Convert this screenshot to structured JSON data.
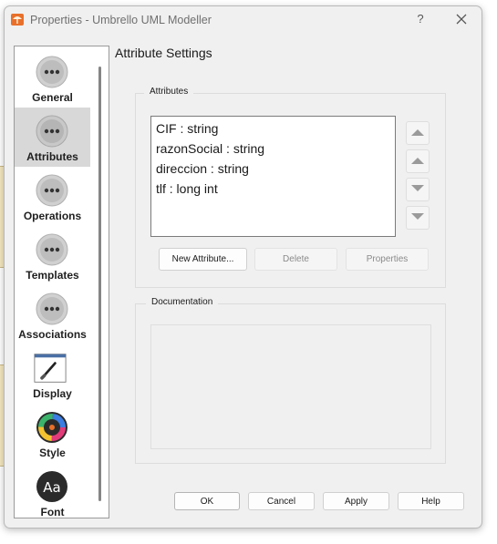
{
  "window": {
    "title": "Properties - Umbrello UML Modeller",
    "help_glyph": "?"
  },
  "sidebar": {
    "items": [
      {
        "label": "General"
      },
      {
        "label": "Attributes"
      },
      {
        "label": "Operations"
      },
      {
        "label": "Templates"
      },
      {
        "label": "Associations"
      },
      {
        "label": "Display"
      },
      {
        "label": "Style"
      },
      {
        "label": "Font"
      }
    ],
    "selected": "Attributes",
    "font_icon_text": "Aa"
  },
  "main": {
    "title": "Attribute Settings",
    "attributes_group_label": "Attributes",
    "attributes": [
      "CIF : string",
      "razonSocial : string",
      "direccion : string",
      "tlf : long int"
    ],
    "buttons": {
      "new_attribute": "New Attribute...",
      "delete": "Delete",
      "properties": "Properties"
    },
    "documentation_group_label": "Documentation"
  },
  "footer": {
    "ok": "OK",
    "cancel": "Cancel",
    "apply": "Apply",
    "help": "Help"
  },
  "colors": {
    "accent_orange": "#e8702a",
    "selection_gray": "#d8d8d8",
    "window_bg": "#f0f0f0"
  }
}
